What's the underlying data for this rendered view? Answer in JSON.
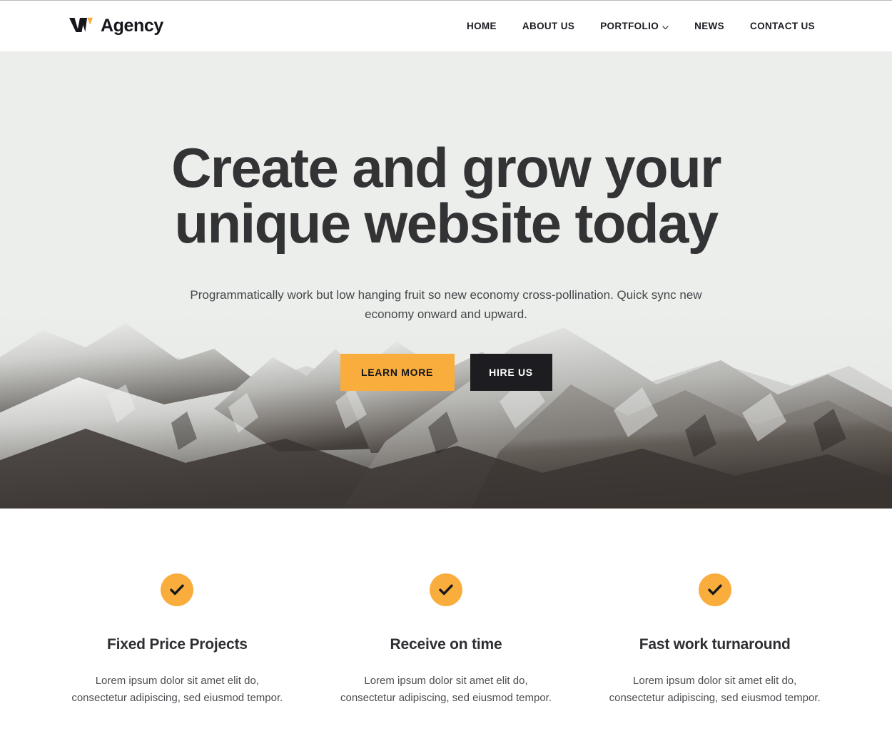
{
  "header": {
    "brand": {
      "name": "Agency",
      "mark_icon": "w-logo-icon",
      "mark_colors": [
        "#15161c",
        "#f9ad3c"
      ]
    },
    "nav": [
      {
        "label": "HOME",
        "has_dropdown": false
      },
      {
        "label": "ABOUT US",
        "has_dropdown": false
      },
      {
        "label": "PORTFOLIO",
        "has_dropdown": true,
        "caret_icon": "chevron-down-icon"
      },
      {
        "label": "NEWS",
        "has_dropdown": false
      },
      {
        "label": "CONTACT US",
        "has_dropdown": false
      }
    ]
  },
  "hero": {
    "title": "Create and grow your unique website today",
    "subtitle": "Programmatically work but low hanging fruit so new economy cross-pollination. Quick sync new economy onward and upward.",
    "buttons": {
      "primary": {
        "label": "LEARN MORE",
        "bg": "#f9ad3c",
        "color": "#15161c"
      },
      "secondary": {
        "label": "HIRE US",
        "bg": "#1d1d21",
        "color": "#ffffff"
      }
    },
    "background": "snow-capped-mountain-range-photo",
    "sky_color": "#edefec"
  },
  "features": [
    {
      "icon": "check-circle-icon",
      "icon_bg": "#f9ad3c",
      "title": "Fixed Price Projects",
      "text": "Lorem ipsum dolor sit amet elit do, consectetur adipiscing, sed eiusmod tempor."
    },
    {
      "icon": "check-circle-icon",
      "icon_bg": "#f9ad3c",
      "title": "Receive on time",
      "text": "Lorem ipsum dolor sit amet elit do, consectetur adipiscing, sed eiusmod tempor."
    },
    {
      "icon": "check-circle-icon",
      "icon_bg": "#f9ad3c",
      "title": "Fast work turnaround",
      "text": "Lorem ipsum dolor sit amet elit do, consectetur adipiscing, sed eiusmod tempor."
    }
  ]
}
